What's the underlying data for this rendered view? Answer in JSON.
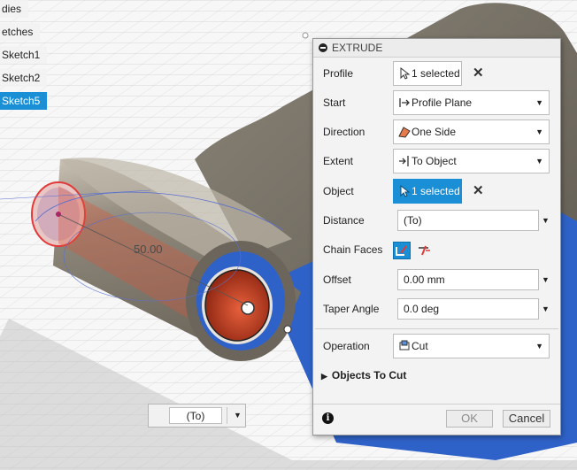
{
  "browser": {
    "items": [
      {
        "label": "dies",
        "selected": false
      },
      {
        "label": "etches",
        "selected": false
      },
      {
        "label": "Sketch1",
        "selected": false
      },
      {
        "label": "Sketch2",
        "selected": false
      },
      {
        "label": "Sketch5",
        "selected": true
      }
    ]
  },
  "viewport": {
    "dimension_label": "50.00",
    "float_input": {
      "value": "(To)"
    }
  },
  "extrude": {
    "title": "EXTRUDE",
    "profile": {
      "label": "Profile",
      "value": "1 selected",
      "icon": "cursor-arrow-icon"
    },
    "start": {
      "label": "Start",
      "value": "Profile Plane",
      "icon": "profile-plane-icon"
    },
    "direction": {
      "label": "Direction",
      "value": "One Side",
      "icon": "one-side-icon"
    },
    "extent": {
      "label": "Extent",
      "value": "To Object",
      "icon": "to-object-icon"
    },
    "object": {
      "label": "Object",
      "value": "1 selected",
      "icon": "cursor-arrow-icon"
    },
    "distance": {
      "label": "Distance",
      "value": "(To)"
    },
    "chain_faces": {
      "label": "Chain Faces"
    },
    "offset": {
      "label": "Offset",
      "value": "0.00 mm"
    },
    "taper_angle": {
      "label": "Taper Angle",
      "value": "0.0 deg"
    },
    "operation": {
      "label": "Operation",
      "value": "Cut",
      "icon": "cut-icon"
    },
    "objects_to_cut": {
      "label": "Objects To Cut"
    },
    "ok_label": "OK",
    "cancel_label": "Cancel"
  },
  "colors": {
    "accent": "#1a8fd6",
    "body_gray": "#8a8478",
    "cut_blue": "#2f62c8",
    "profile_red": "#c8432c"
  }
}
